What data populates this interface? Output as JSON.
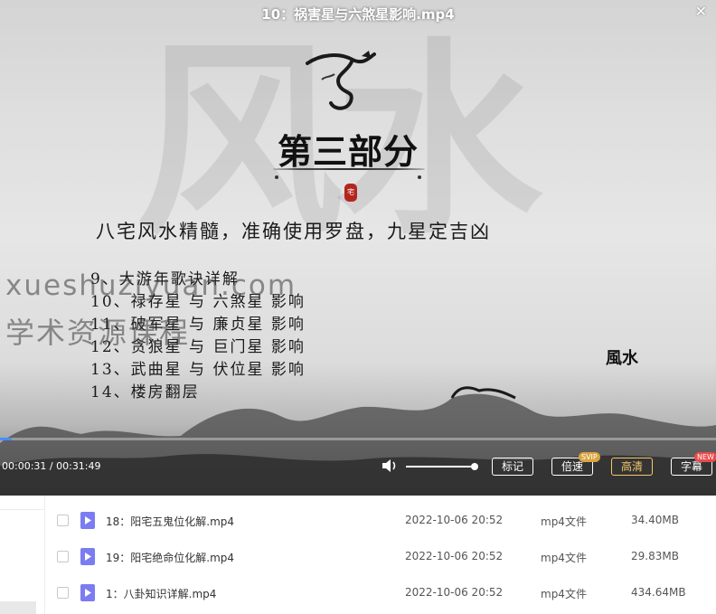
{
  "player": {
    "title": "10：祸害星与六煞星影响.mp4",
    "close_icon": "close-icon",
    "background_char": "风水",
    "slide": {
      "section_heading": "第三部分",
      "seal_text": "宅",
      "subtitle": "八宅风水精髓，准确使用罗盘，九星定吉凶",
      "chapters": [
        "9、大游年歌诀详解",
        "10、禄存星 与 六煞星 影响",
        "11、破军星 与 廉贞星 影响",
        "12、贪狼星 与 巨门星 影响",
        "13、武曲星 与 伏位星 影响",
        "14、楼房翻层"
      ],
      "logo_text": "風水"
    },
    "watermark": {
      "line1": "xueshuziyuan.com",
      "line2": "学术资源课程"
    },
    "controls": {
      "current_time": "00:00:31",
      "duration": "00:31:49",
      "progress_fraction": 0.016,
      "volume_fraction": 1.0,
      "volume_icon": "volume-icon",
      "buttons": {
        "mark": "标记",
        "speed": "倍速",
        "quality": "高清",
        "subtitle": "字幕"
      },
      "badges": {
        "speed": "SVIP",
        "subtitle": "NEW"
      }
    },
    "colors": {
      "progress": "#4a8df8",
      "quality_highlight": "#f5c86b",
      "svip_badge": "#d9a441",
      "new_badge": "#e94b4b"
    }
  },
  "file_list": {
    "icon": "video-file-icon",
    "icon_color": "#7c7cf2",
    "rows": [
      {
        "name": "18：阳宅五鬼位化解.mp4",
        "date": "2022-10-06 20:52",
        "type": "mp4文件",
        "size": "34.40MB"
      },
      {
        "name": "19：阳宅绝命位化解.mp4",
        "date": "2022-10-06 20:52",
        "type": "mp4文件",
        "size": "29.83MB"
      },
      {
        "name": "1：八卦知识详解.mp4",
        "date": "2022-10-06 20:52",
        "type": "mp4文件",
        "size": "434.64MB"
      }
    ]
  }
}
